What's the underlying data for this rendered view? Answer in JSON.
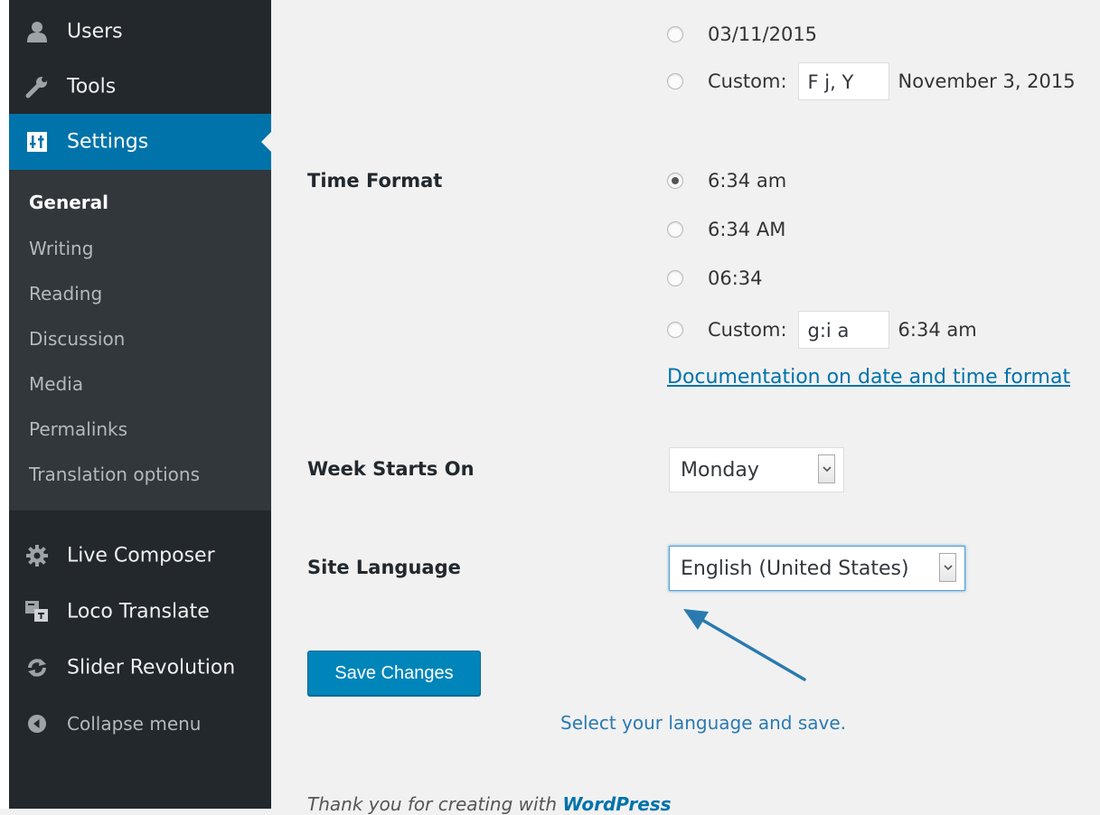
{
  "sidebar": {
    "top_items": [
      {
        "label": "Users",
        "icon": "users-icon"
      },
      {
        "label": "Tools",
        "icon": "wrench-icon"
      },
      {
        "label": "Settings",
        "icon": "settings-icon",
        "active": true
      }
    ],
    "submenu": [
      "General",
      "Writing",
      "Reading",
      "Discussion",
      "Media",
      "Permalinks",
      "Translation options"
    ],
    "current_submenu": "General",
    "plugins": [
      {
        "label": "Live Composer",
        "icon": "gear-icon"
      },
      {
        "label": "Loco Translate",
        "icon": "translate-icon"
      },
      {
        "label": "Slider Revolution",
        "icon": "refresh-icon"
      }
    ],
    "collapse_label": "Collapse menu"
  },
  "date_format": {
    "option_date": "03/11/2015",
    "custom_label": "Custom:",
    "custom_value": "F j, Y",
    "custom_preview": "November 3, 2015"
  },
  "time_format": {
    "label": "Time Format",
    "options": [
      "6:34 am",
      "6:34 AM",
      "06:34"
    ],
    "selected": "6:34 am",
    "custom_label": "Custom:",
    "custom_value": "g:i a",
    "custom_preview": "6:34 am",
    "doc_link": "Documentation on date and time format"
  },
  "week_starts_on": {
    "label": "Week Starts On",
    "value": "Monday"
  },
  "site_language": {
    "label": "Site Language",
    "value": "English (United States)"
  },
  "save_button": "Save Changes",
  "annotation": "Select your language and save.",
  "footer": {
    "text": "Thank you for creating with ",
    "link": "WordPress"
  },
  "colors": {
    "sidebar_bg": "#23282d",
    "submenu_bg": "#32373c",
    "accent": "#0073aa",
    "button": "#0085ba",
    "annotation": "#2a7ab0"
  }
}
